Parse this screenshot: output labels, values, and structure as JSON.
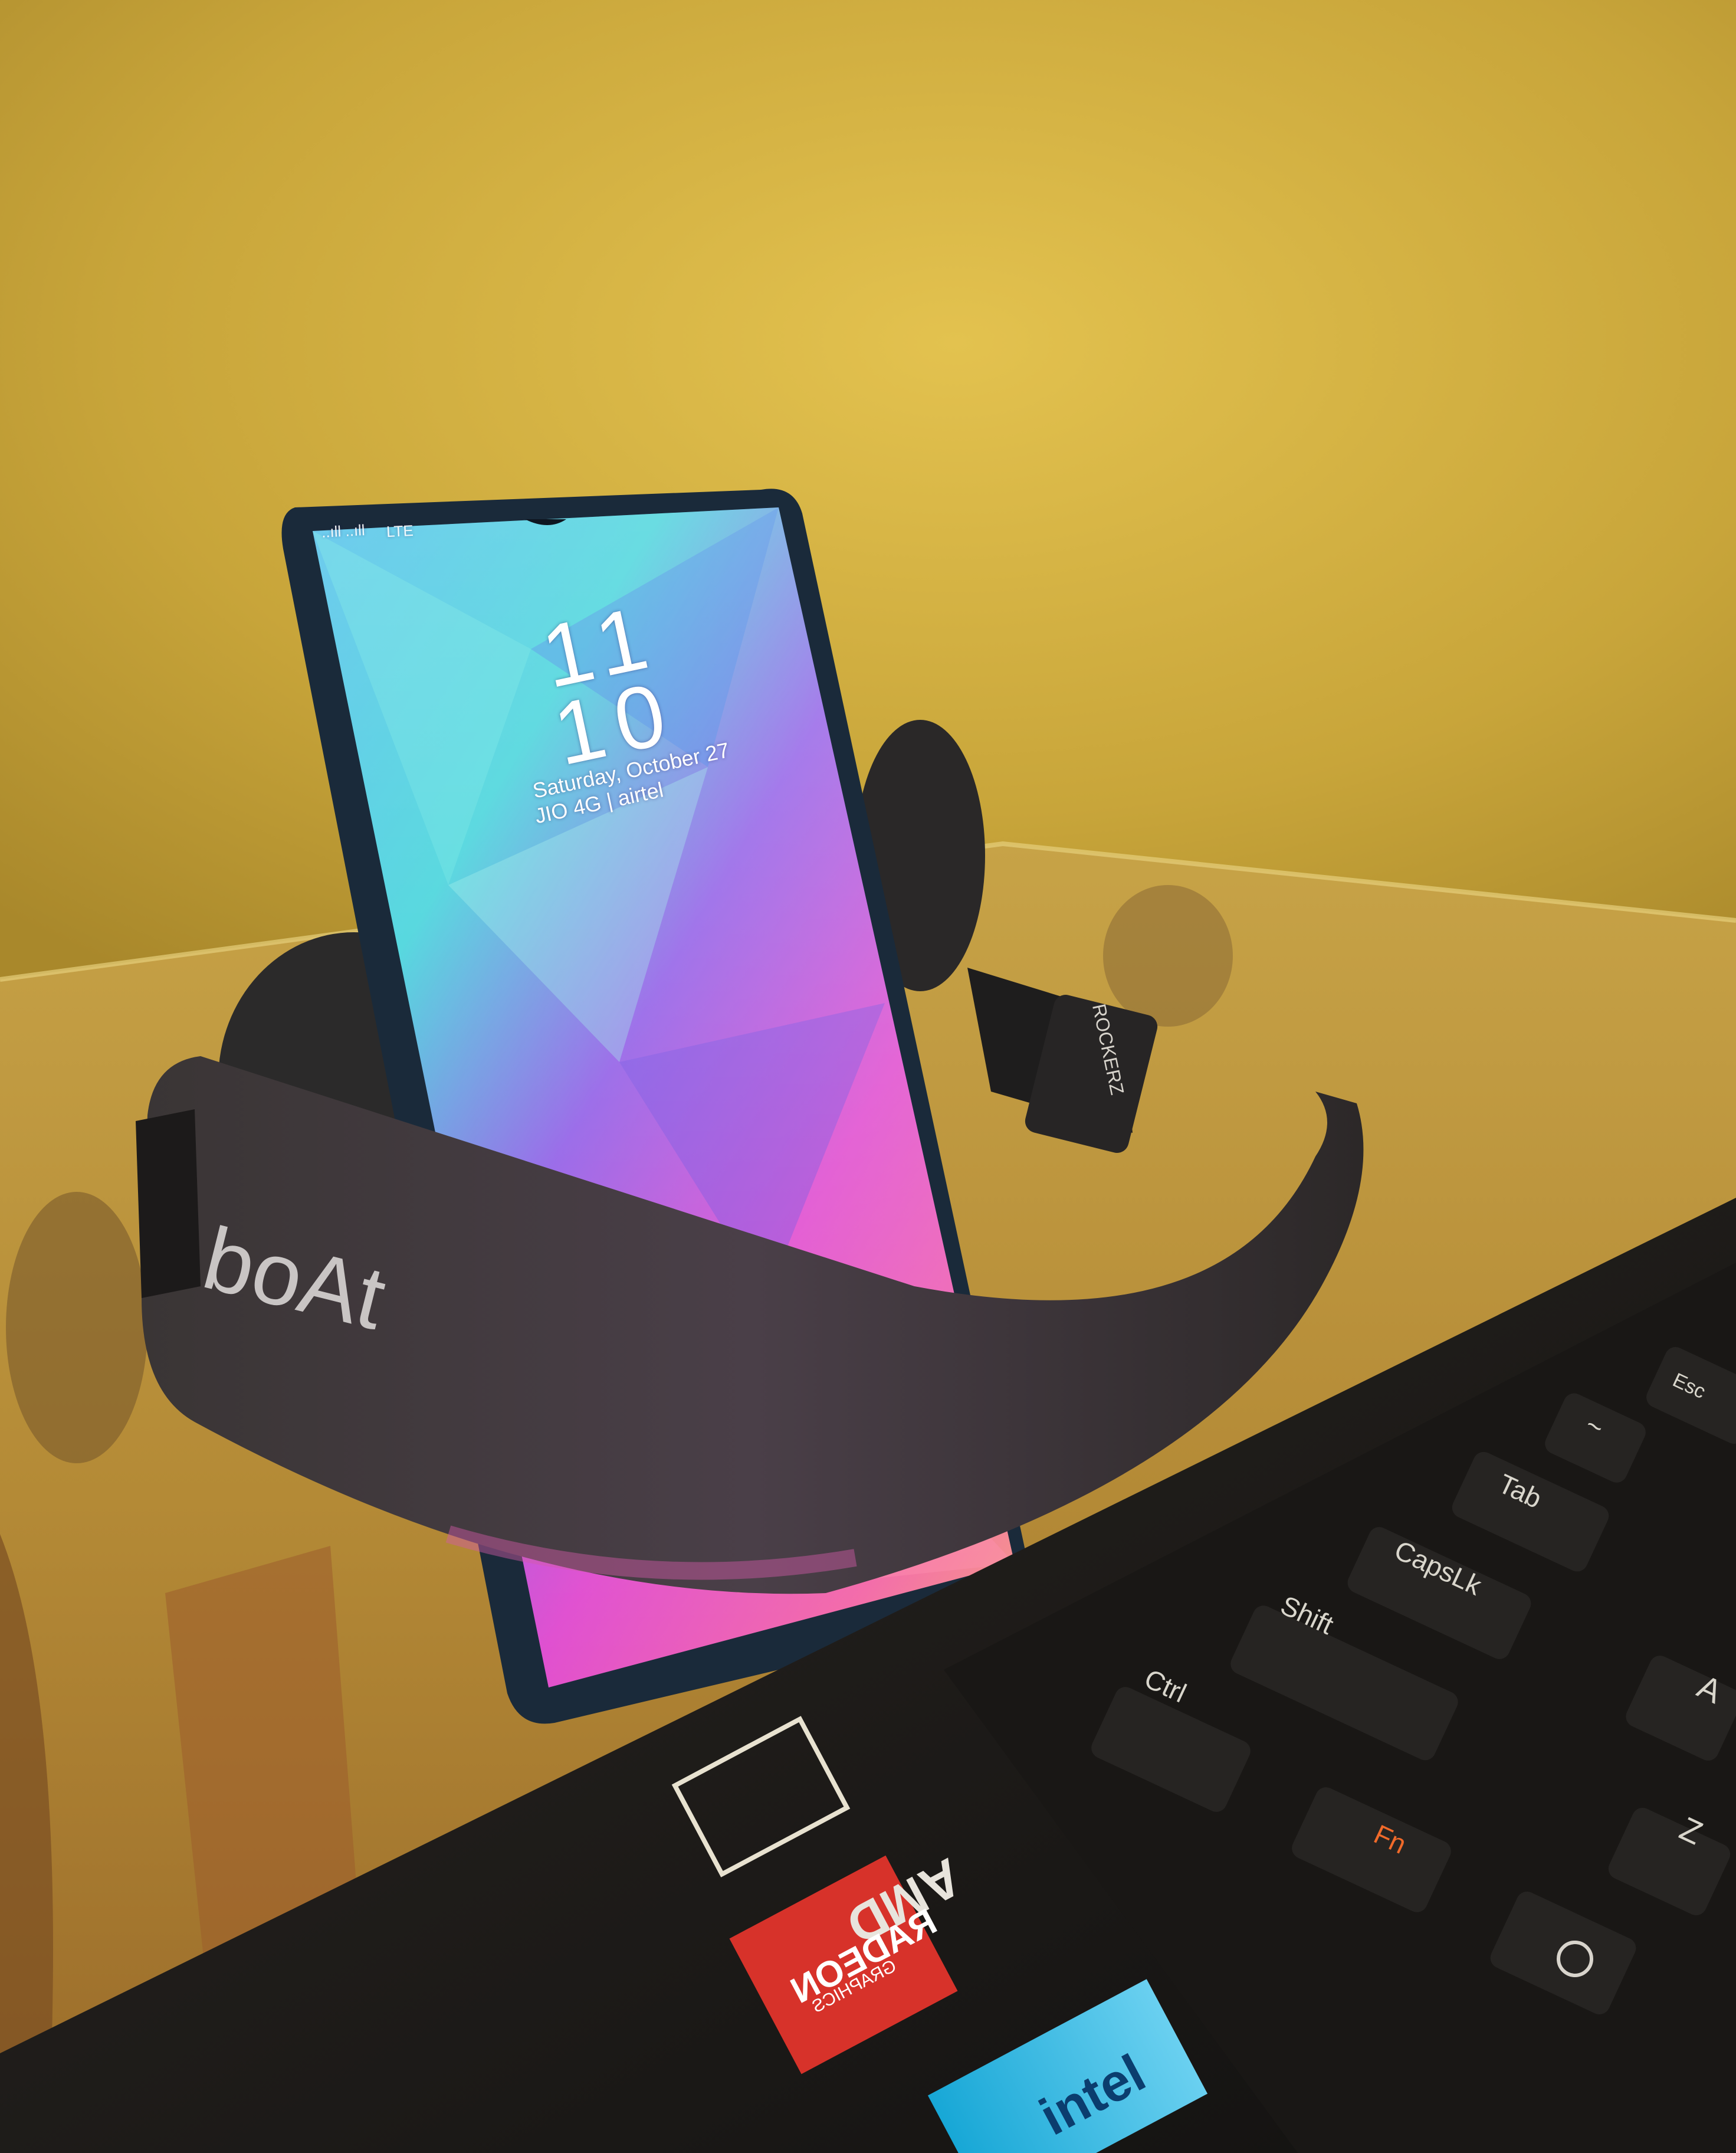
{
  "phone": {
    "status_left": "..ıll ..ıll",
    "status_net": "LTE",
    "clock_hour": "11",
    "clock_minute": "10",
    "date": "Saturday, October 27",
    "carrier": "JIO 4G | airtel"
  },
  "headphones": {
    "brand": "boAt",
    "model": "ROCKERZ"
  },
  "laptop": {
    "keys": {
      "esc": "Esc",
      "tilde": "~",
      "tab": "Tab",
      "capslock": "CapsLk",
      "shift": "Shift",
      "ctrl": "Ctrl",
      "fn": "Fn",
      "a": "A",
      "z": "Z"
    },
    "stickers": {
      "amd": "AMD",
      "radeon": "RADEON",
      "radeon_sub": "GRAPHICS",
      "intel": "intel"
    }
  },
  "colors": {
    "wall": "#c9a83a",
    "table_glass": "#b98f34",
    "laptop_body": "#1c1a18",
    "fn_key_label": "#f06a2a",
    "radeon_red": "#d7322a"
  }
}
